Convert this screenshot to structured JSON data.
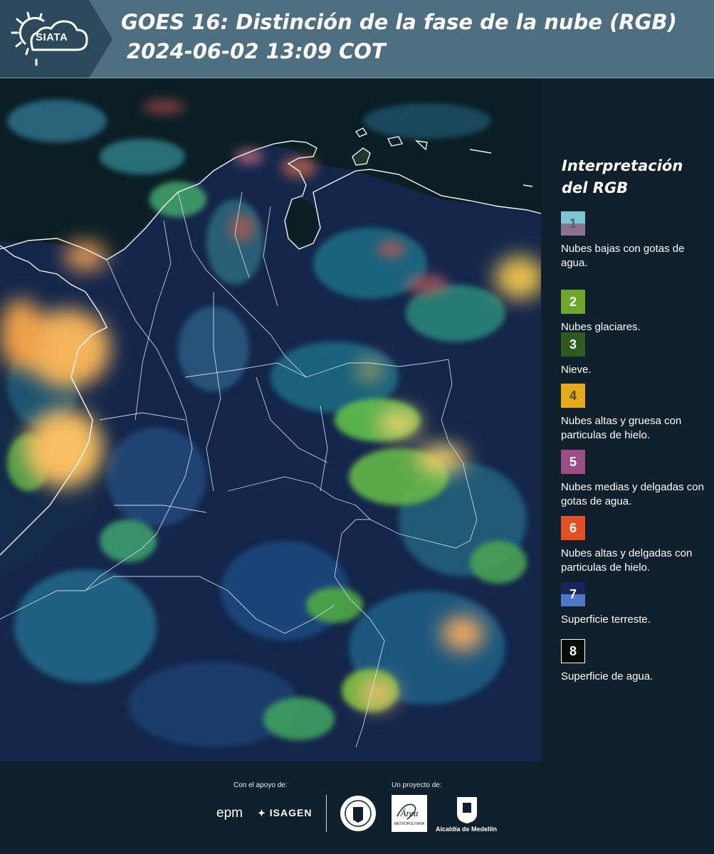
{
  "header": {
    "logo_text": "SIATA",
    "title_line1": "GOES 16: Distinción de la fase de la nube (RGB)",
    "title_line2": "2024-06-02 13:09 COT"
  },
  "legend": {
    "title": "Interpretación del RGB",
    "items": [
      {
        "number": "1",
        "label": "Nubes bajas con gotas de agua.",
        "color_top": "#7fc4d2",
        "color_bottom": "#8b7291",
        "text_color": "#4d5d68"
      },
      {
        "number": "2",
        "label": "Nubes glaciares.",
        "color_top": "#6ea62c",
        "color_bottom": "#6ea62c",
        "text_color": "#ffffff"
      },
      {
        "number": "3",
        "label": "Nieve.",
        "color_top": "#2f5a1e",
        "color_bottom": "#2f5a1e",
        "text_color": "#ffffff"
      },
      {
        "number": "4",
        "label": "Nubes altas y gruesa con particulas de hielo.",
        "color_top": "#e6aa18",
        "color_bottom": "#e6aa18",
        "text_color": "#4d4a3a"
      },
      {
        "number": "5",
        "label": "Nubes medias y delgadas con gotas de agua.",
        "color_top": "#9e4c84",
        "color_bottom": "#9e4c84",
        "text_color": "#ffffff"
      },
      {
        "number": "6",
        "label": "Nubes altas y delgadas con particulas de hielo.",
        "color_top": "#e54f25",
        "color_bottom": "#e54f25",
        "text_color": "#ffffff"
      },
      {
        "number": "7",
        "label": "Superficie terreste.",
        "color_top": "#18255a",
        "color_bottom": "#4d78c8",
        "text_color": "#ffffff"
      },
      {
        "number": "8",
        "label": "Superficie de agua.",
        "color_top": "#050d08",
        "color_bottom": "#050d08",
        "text_color": "#ffffff"
      }
    ]
  },
  "footer": {
    "support_label": "Con el apoyo de:",
    "project_label": "Un proyecto de:",
    "epm": "epm",
    "isagen": "ISAGEN",
    "area_metro": "Área",
    "area_metro_sub": "METROPOLITANA",
    "alcaldia": "Alcaldía de Medellín"
  }
}
